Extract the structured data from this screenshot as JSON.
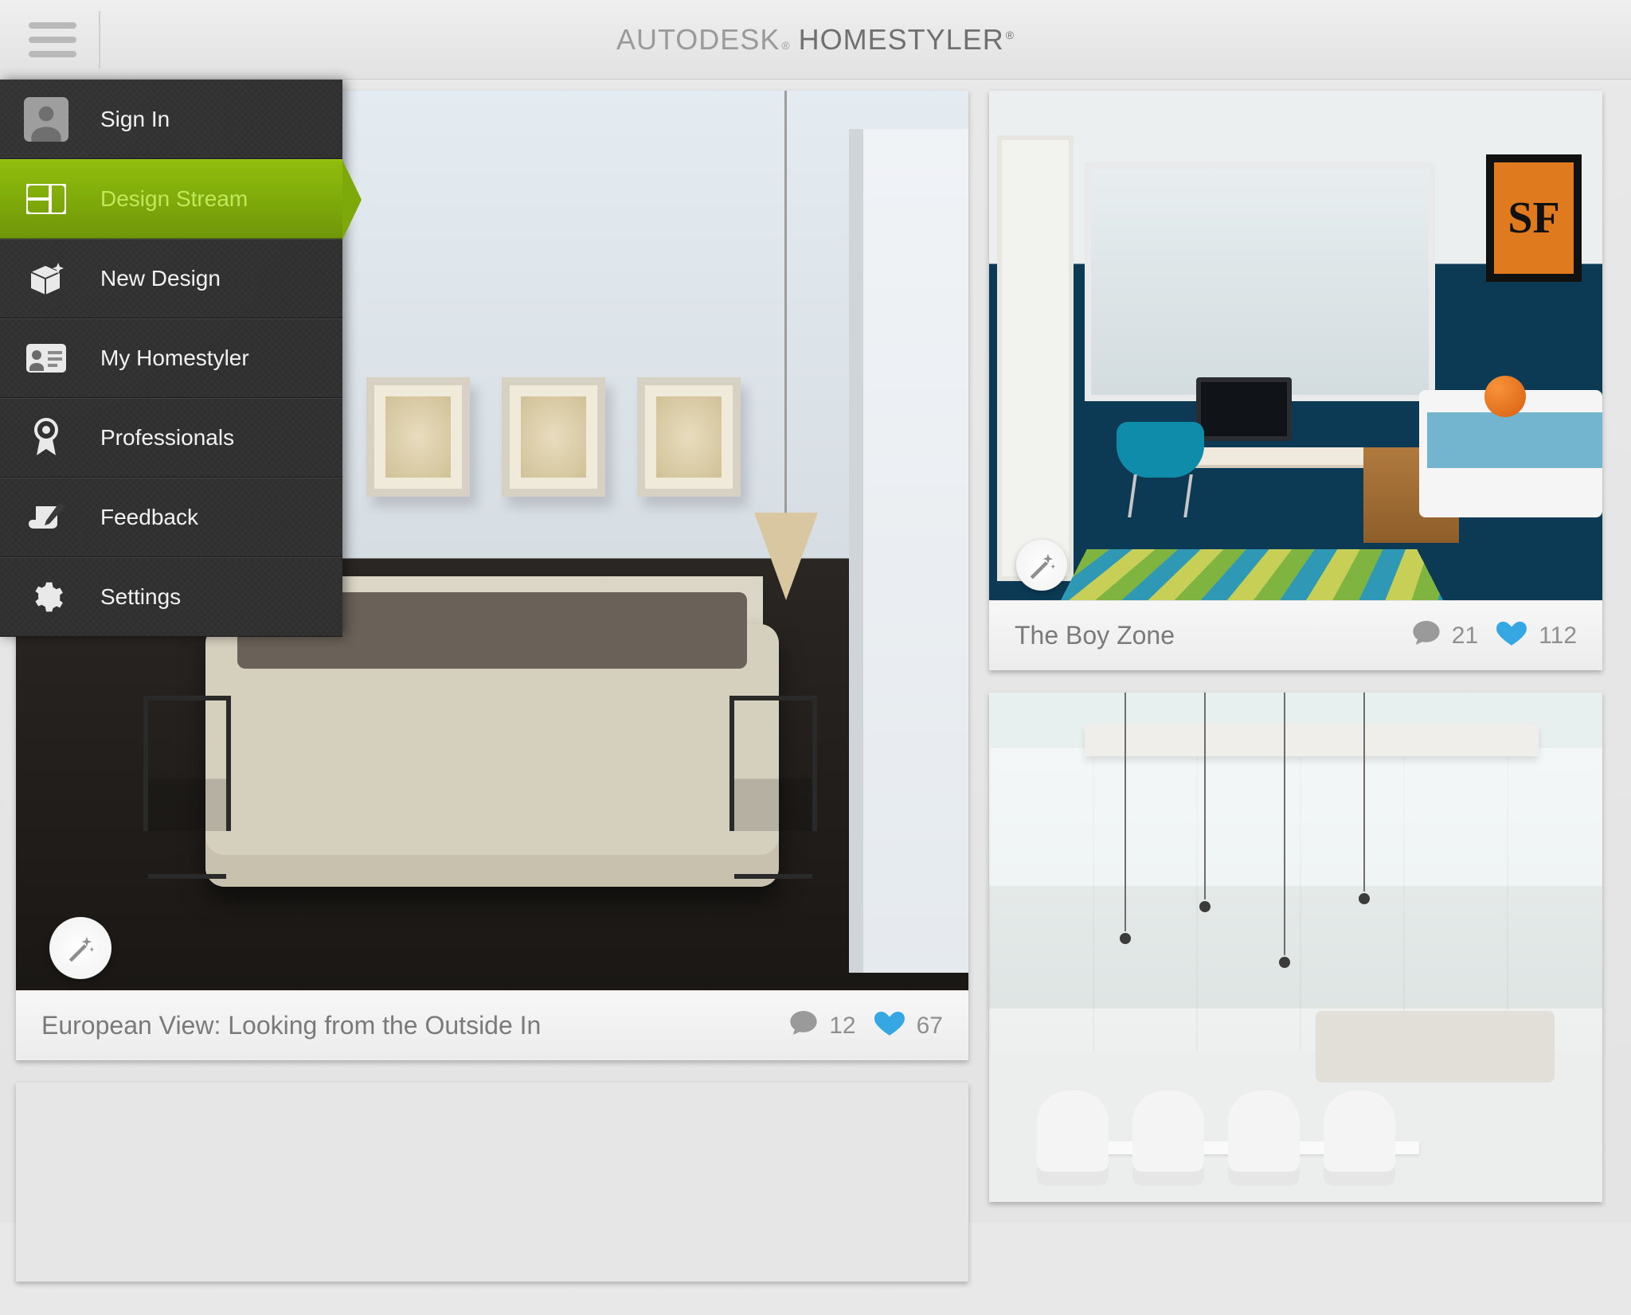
{
  "brand": {
    "company": "AUTODESK",
    "product_strong": "HOME",
    "product_rest": "STYLER"
  },
  "sidebar": {
    "items": [
      {
        "label": "Sign In"
      },
      {
        "label": "Design Stream"
      },
      {
        "label": "New Design"
      },
      {
        "label": "My Homestyler"
      },
      {
        "label": "Professionals"
      },
      {
        "label": "Feedback"
      },
      {
        "label": "Settings"
      }
    ],
    "active_index": 1
  },
  "cards": {
    "left": {
      "title": "European View: Looking from the Outside In",
      "comments": "12",
      "likes": "67"
    },
    "right_top": {
      "title": "The Boy Zone",
      "comments": "21",
      "likes": "112",
      "poster_text": "SF"
    }
  },
  "colors": {
    "accent_green": "#8cb70c",
    "like_blue": "#35a7e3",
    "comment_gray": "#9a9a9a"
  }
}
